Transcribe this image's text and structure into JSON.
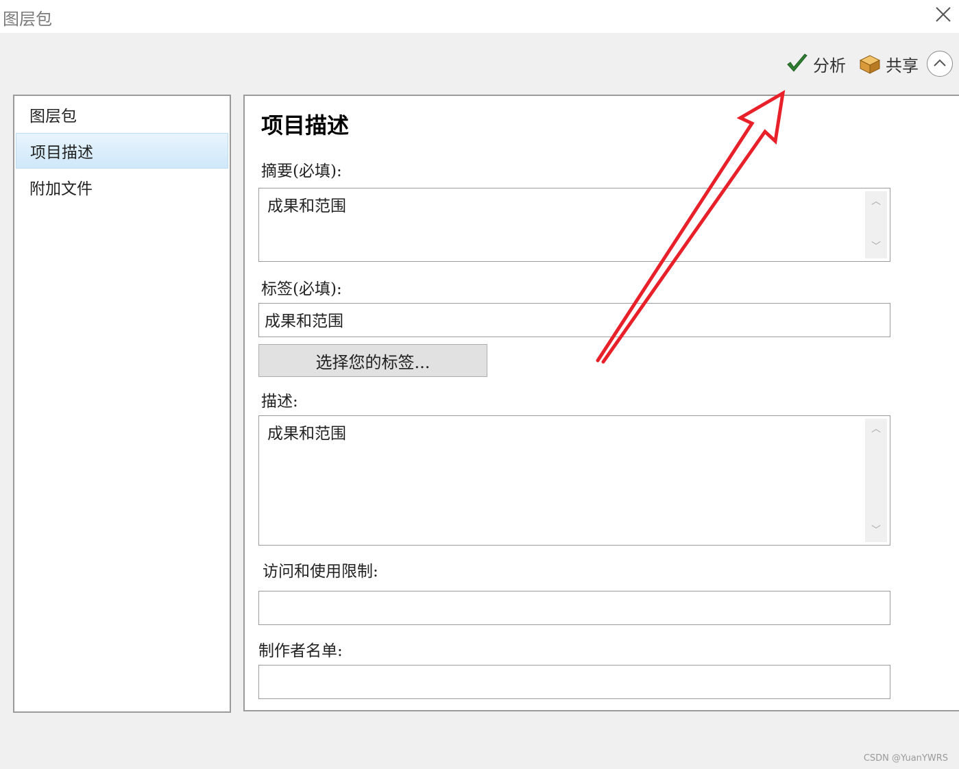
{
  "window": {
    "title": "图层包"
  },
  "toolbar": {
    "analyze_label": "分析",
    "share_label": "共享",
    "icons": {
      "analyze": "checkmark-icon",
      "share": "package-icon",
      "collapse": "chevron-up-icon",
      "close": "close-icon"
    }
  },
  "sidebar": {
    "items": [
      {
        "label": "图层包",
        "active": false
      },
      {
        "label": "项目描述",
        "active": true
      },
      {
        "label": "附加文件",
        "active": false
      }
    ]
  },
  "main": {
    "title": "项目描述",
    "summary": {
      "label": "摘要(必填):",
      "value": "成果和范围"
    },
    "tags": {
      "label": "标签(必填):",
      "value": "成果和范围",
      "button_label": "选择您的标签..."
    },
    "description": {
      "label": "描述:",
      "value": "成果和范围"
    },
    "access": {
      "label": "访问和使用限制:",
      "value": ""
    },
    "credits": {
      "label": "制作者名单:",
      "value": ""
    }
  },
  "watermark": "CSDN @YuanYWRS",
  "colors": {
    "annotation_arrow": "#e8202a",
    "active_nav": "#cfe8f9",
    "check_green": "#2e7d32"
  }
}
